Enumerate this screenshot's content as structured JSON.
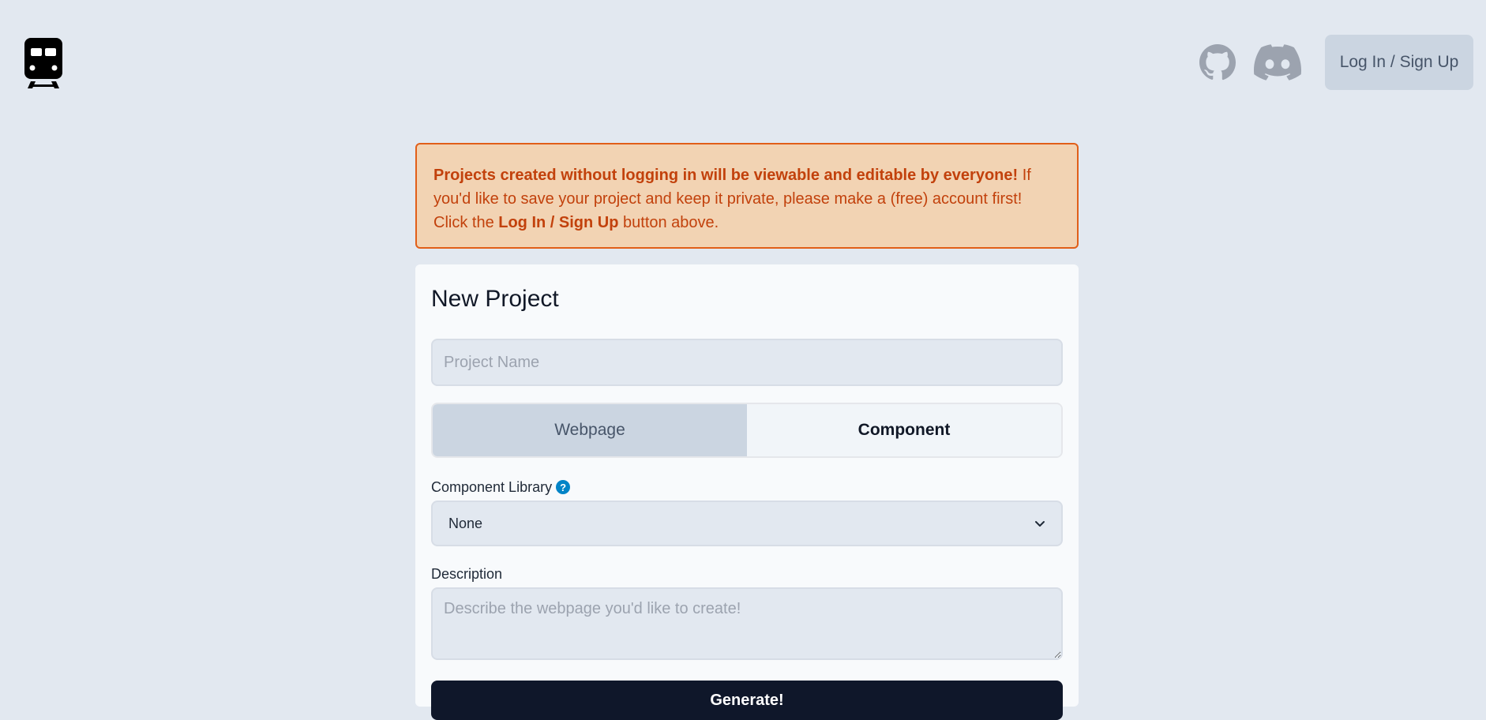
{
  "header": {
    "logo_icon": "train-icon",
    "github_icon": "github-icon",
    "discord_icon": "discord-icon",
    "login_label": "Log In / Sign Up"
  },
  "alert": {
    "bold_lead": "Projects created without logging in will be viewable and editable by everyone!",
    "text_middle": " If you'd like to save your project and keep it private, please make a (free) account first! Click the ",
    "bold_button": "Log In / Sign Up",
    "text_end": " button above."
  },
  "form": {
    "title": "New Project",
    "project_name_placeholder": "Project Name",
    "project_name_value": "",
    "type_options": [
      "Webpage",
      "Component"
    ],
    "selected_type": "Webpage",
    "component_library_label": "Component Library",
    "help_icon": "help-icon",
    "component_library_value": "None",
    "description_label": "Description",
    "description_placeholder": "Describe the webpage you'd like to create!",
    "generate_label": "Generate!"
  },
  "colors": {
    "background": "#e2e8f0",
    "alert_bg": "#f2d3b3",
    "alert_border": "#e15f19",
    "alert_text": "#c2410c",
    "card_bg": "#f8fafc",
    "primary_button": "#0f172a",
    "help_icon": "#0284c7"
  }
}
